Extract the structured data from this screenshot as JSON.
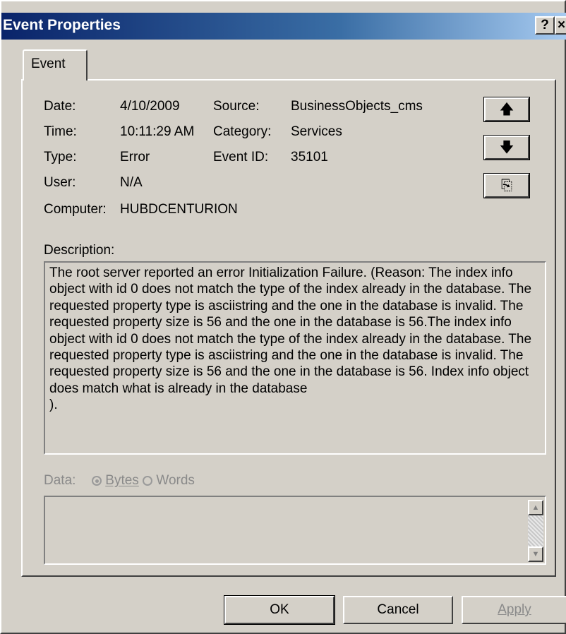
{
  "window": {
    "title": "Event Properties",
    "help_glyph": "?",
    "close_glyph": "×"
  },
  "tabs": [
    {
      "label": "Event",
      "selected": true
    }
  ],
  "fields": {
    "date_label": "Date:",
    "date_value": "4/10/2009",
    "time_label": "Time:",
    "time_value": "10:11:29 AM",
    "type_label": "Type:",
    "type_value": "Error",
    "user_label": "User:",
    "user_value": "N/A",
    "computer_label": "Computer:",
    "computer_value": "HUBDCENTURION",
    "source_label": "Source:",
    "source_value": "BusinessObjects_cms",
    "category_label": "Category:",
    "category_value": "Services",
    "event_id_label": "Event ID:",
    "event_id_value": "35101"
  },
  "nav": {
    "up_glyph": "🡅",
    "down_glyph": "🡇",
    "copy_glyph": "⎘"
  },
  "description": {
    "label": "Description:",
    "text": "The root server reported an error Initialization Failure. (Reason: The index info object with id 0 does not match the type of the index already in the database. The requested property type is asciistring and the one in the database is invalid. The requested property size is 56 and the one in the database is 56.The index info object with id 0 does not match the type of the index already in the database. The requested property type is asciistring and the one in the database is invalid. The requested property size is 56 and the one in the database is 56. Index info object does match what is already in the database\n)."
  },
  "data_section": {
    "label": "Data:",
    "bytes_label": "Bytes",
    "words_label": "Words",
    "selected": "Bytes"
  },
  "buttons": {
    "ok": "OK",
    "cancel": "Cancel",
    "apply": "Apply"
  },
  "colors": {
    "face": "#d4d0c8",
    "titlebar_start": "#0a246a",
    "titlebar_end": "#a6caf0"
  }
}
